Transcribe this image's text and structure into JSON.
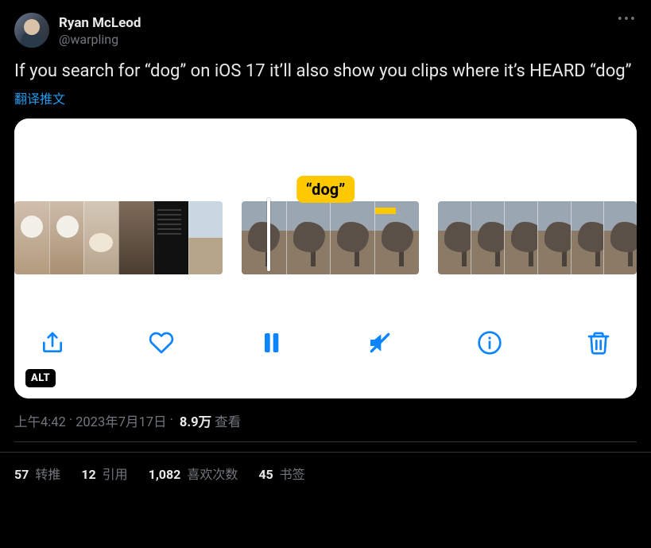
{
  "author": {
    "display_name": "Ryan McLeod",
    "handle": "@warpling"
  },
  "tweet_text": "If you search for “dog” on iOS 17 it’ll also show you clips where it’s HEARD “dog”",
  "translate_label": "翻译推文",
  "media": {
    "caption_bubble": "“dog”",
    "alt_badge": "ALT"
  },
  "toolbar_icons": {
    "share": "share-icon",
    "like": "heart-icon",
    "pause": "pause-icon",
    "mute": "speaker-muted-icon",
    "info": "info-icon",
    "delete": "trash-icon"
  },
  "meta": {
    "time": "上午4:42",
    "dot1": " · ",
    "date": "2023年7月17日",
    "dot2": " · ",
    "views_count": "8.9万",
    "views_label": " 查看"
  },
  "stats": {
    "retweets_count": "57",
    "retweets_label": " 转推",
    "quotes_count": "12",
    "quotes_label": " 引用",
    "likes_count": "1,082",
    "likes_label": " 喜欢次数",
    "bookmarks_count": "45",
    "bookmarks_label": " 书签"
  },
  "more_label": "•••"
}
